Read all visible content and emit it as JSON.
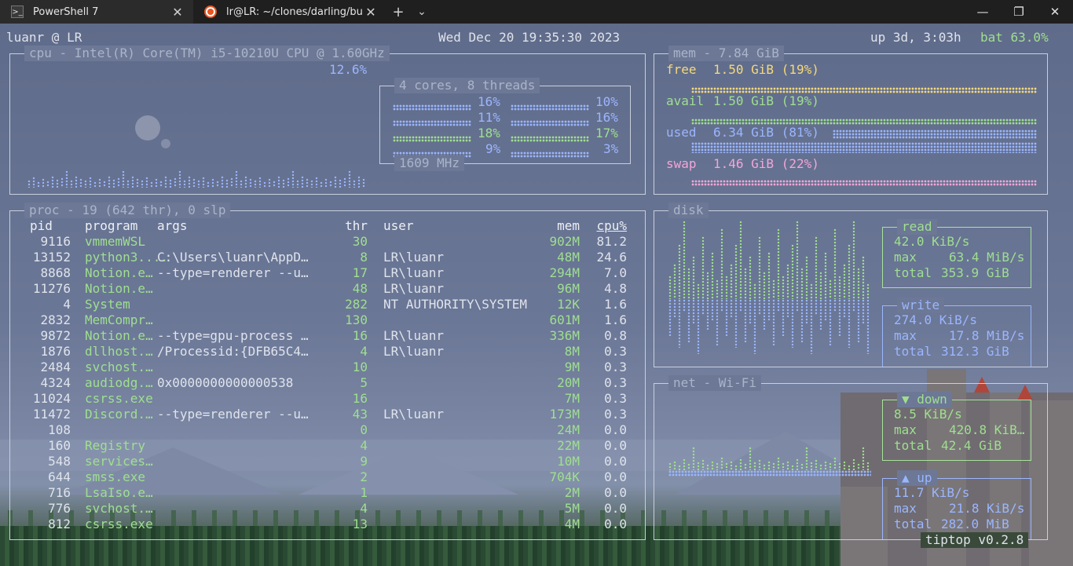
{
  "titlebar": {
    "tabs": [
      {
        "label": "PowerShell 7",
        "icon": "powershell-icon",
        "active": true
      },
      {
        "label": "lr@LR: ~/clones/darling/build",
        "icon": "ubuntu-icon",
        "active": false
      }
    ],
    "new_tab": "+",
    "dropdown": "⌄",
    "minimize": "—",
    "restore": "❐",
    "close": "✕"
  },
  "top": {
    "user_host": "luanr @ LR",
    "datetime": "Wed Dec 20 19:35:30 2023",
    "uptime": "up 3d, 3:03h",
    "battery": "bat 63.0%"
  },
  "cpu": {
    "title": "cpu - Intel(R) Core(TM) i5-10210U CPU @ 1.60GHz",
    "total": "12.6%",
    "cores_title": "4 cores, 8 threads",
    "threads": [
      "16%",
      "10%",
      "11%",
      "16%",
      "18%",
      "17%",
      "9%",
      "3%"
    ],
    "freq": "1609 MHz"
  },
  "mem": {
    "title": "mem - 7.84 GiB",
    "free": {
      "label": "free",
      "value": "1.50 GiB (19%)"
    },
    "avail": {
      "label": "avail",
      "value": "1.50 GiB (19%)"
    },
    "used": {
      "label": "used",
      "value": "6.34 GiB (81%)"
    },
    "swap": {
      "label": "swap",
      "value": "1.46 GiB (22%)"
    }
  },
  "proc": {
    "title": "proc - 19 (642 thr), 0 slp",
    "headers": {
      "pid": "pid",
      "program": "program",
      "args": "args",
      "thr": "thr",
      "user": "user",
      "mem": "mem",
      "cpu": "cpu%"
    },
    "rows": [
      {
        "pid": "9116",
        "program": "vmmemWSL",
        "args": "",
        "thr": "30",
        "user": "",
        "mem": "902M",
        "cpu": "81.2"
      },
      {
        "pid": "13152",
        "program": "python3....",
        "args": "C:\\Users\\luanr\\AppD…",
        "thr": "8",
        "user": "LR\\luanr",
        "mem": "48M",
        "cpu": "24.6"
      },
      {
        "pid": "8868",
        "program": "Notion.e…",
        "args": "--type=renderer --u…",
        "thr": "17",
        "user": "LR\\luanr",
        "mem": "294M",
        "cpu": "7.0"
      },
      {
        "pid": "11276",
        "program": "Notion.e…",
        "args": "",
        "thr": "48",
        "user": "LR\\luanr",
        "mem": "96M",
        "cpu": "4.8"
      },
      {
        "pid": "4",
        "program": "System",
        "args": "",
        "thr": "282",
        "user": "NT AUTHORITY\\SYSTEM",
        "mem": "12K",
        "cpu": "1.6"
      },
      {
        "pid": "2832",
        "program": "MemCompr…",
        "args": "",
        "thr": "130",
        "user": "",
        "mem": "601M",
        "cpu": "1.6"
      },
      {
        "pid": "9872",
        "program": "Notion.e…",
        "args": "--type=gpu-process …",
        "thr": "16",
        "user": "LR\\luanr",
        "mem": "336M",
        "cpu": "0.8"
      },
      {
        "pid": "1876",
        "program": "dllhost.…",
        "args": "/Processid:{DFB65C4…",
        "thr": "4",
        "user": "LR\\luanr",
        "mem": "8M",
        "cpu": "0.3"
      },
      {
        "pid": "2484",
        "program": "svchost.…",
        "args": "",
        "thr": "10",
        "user": "",
        "mem": "9M",
        "cpu": "0.3"
      },
      {
        "pid": "4324",
        "program": "audiodg.…",
        "args": "0x0000000000000538",
        "thr": "5",
        "user": "",
        "mem": "20M",
        "cpu": "0.3"
      },
      {
        "pid": "11024",
        "program": "csrss.exe",
        "args": "",
        "thr": "16",
        "user": "",
        "mem": "7M",
        "cpu": "0.3"
      },
      {
        "pid": "11472",
        "program": "Discord.…",
        "args": "--type=renderer --u…",
        "thr": "43",
        "user": "LR\\luanr",
        "mem": "173M",
        "cpu": "0.3"
      },
      {
        "pid": "108",
        "program": "",
        "args": "",
        "thr": "0",
        "user": "",
        "mem": "24M",
        "cpu": "0.0"
      },
      {
        "pid": "160",
        "program": "Registry",
        "args": "",
        "thr": "4",
        "user": "",
        "mem": "22M",
        "cpu": "0.0"
      },
      {
        "pid": "548",
        "program": "services…",
        "args": "",
        "thr": "9",
        "user": "",
        "mem": "10M",
        "cpu": "0.0"
      },
      {
        "pid": "644",
        "program": "smss.exe",
        "args": "",
        "thr": "2",
        "user": "",
        "mem": "704K",
        "cpu": "0.0"
      },
      {
        "pid": "716",
        "program": "LsaIso.e…",
        "args": "",
        "thr": "1",
        "user": "",
        "mem": "2M",
        "cpu": "0.0"
      },
      {
        "pid": "776",
        "program": "svchost.…",
        "args": "",
        "thr": "4",
        "user": "",
        "mem": "5M",
        "cpu": "0.0"
      },
      {
        "pid": "812",
        "program": "csrss.exe",
        "args": "",
        "thr": "13",
        "user": "",
        "mem": "4M",
        "cpu": "0.0"
      }
    ]
  },
  "disk": {
    "title": "disk",
    "read": {
      "title": "read",
      "rate": "42.0 KiB/s",
      "max_label": "max",
      "max": "63.4 MiB/s",
      "total_label": "total",
      "total": "353.9 GiB"
    },
    "write": {
      "title": "write",
      "rate": "274.0 KiB/s",
      "max_label": "max",
      "max": "17.8 MiB/s",
      "total_label": "total",
      "total": "312.3 GiB"
    }
  },
  "net": {
    "title": "net - Wi-Fi",
    "down": {
      "title": "▼ down",
      "rate": "8.5 KiB/s",
      "max_label": "max",
      "max": "420.8 KiB…",
      "total_label": "total",
      "total": "42.4 GiB"
    },
    "up": {
      "title": "▲ up",
      "rate": "11.7 KiB/s",
      "max_label": "max",
      "max": "21.8 KiB/s",
      "total_label": "total",
      "total": "282.0 MiB"
    }
  },
  "footer": {
    "version": "tiptop v0.2.8"
  },
  "colors": {
    "green": "#9fdf8f",
    "blue": "#9bb6ff",
    "yellow": "#f5d97b",
    "pink": "#f2a6d8"
  }
}
